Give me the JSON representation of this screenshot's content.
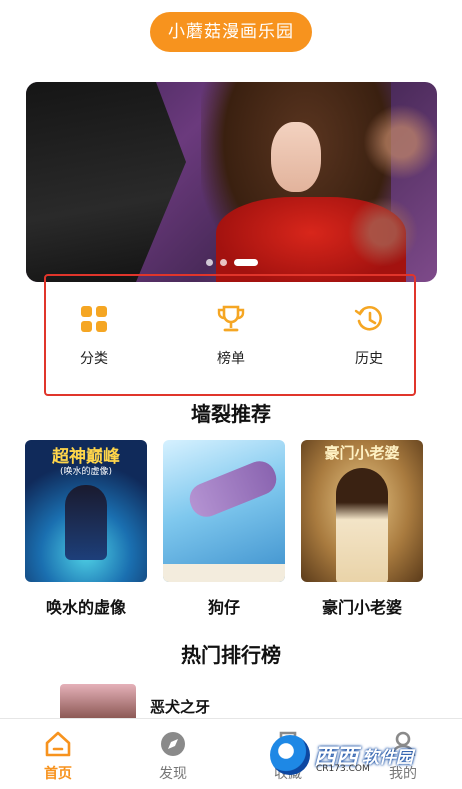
{
  "header": {
    "title": "小蘑菇漫画乐园"
  },
  "banner": {
    "slides": 3,
    "active_slide": 2
  },
  "quick_links": [
    {
      "label": "分类",
      "icon": "grid-icon"
    },
    {
      "label": "榜单",
      "icon": "trophy-icon"
    },
    {
      "label": "历史",
      "icon": "history-icon"
    }
  ],
  "recommend": {
    "title": "墙裂推荐",
    "books": [
      {
        "title": "唤水的虚像",
        "cover_text": "超神巅峰",
        "cover_sub": "(唤水的虚像)"
      },
      {
        "title": "狗仔",
        "cover_text": "",
        "cover_sub": ""
      },
      {
        "title": "豪门小老婆",
        "cover_text": "豪门小老婆",
        "cover_sub": ""
      }
    ]
  },
  "ranking": {
    "title": "热门排行榜",
    "items": [
      {
        "title": "恶犬之牙"
      }
    ]
  },
  "tabbar": {
    "tabs": [
      {
        "label": "首页",
        "icon": "home-icon",
        "active": true
      },
      {
        "label": "发现",
        "icon": "compass-icon",
        "active": false
      },
      {
        "label": "收藏",
        "icon": "bookmark-icon",
        "active": false
      },
      {
        "label": "我的",
        "icon": "user-icon",
        "active": false
      }
    ]
  },
  "watermark": {
    "text": "西西",
    "sub": "软件园",
    "url": "CR173.COM"
  },
  "colors": {
    "accent": "#f7931e",
    "highlight_box": "#e0352b",
    "icon_color": "#f5a623"
  }
}
